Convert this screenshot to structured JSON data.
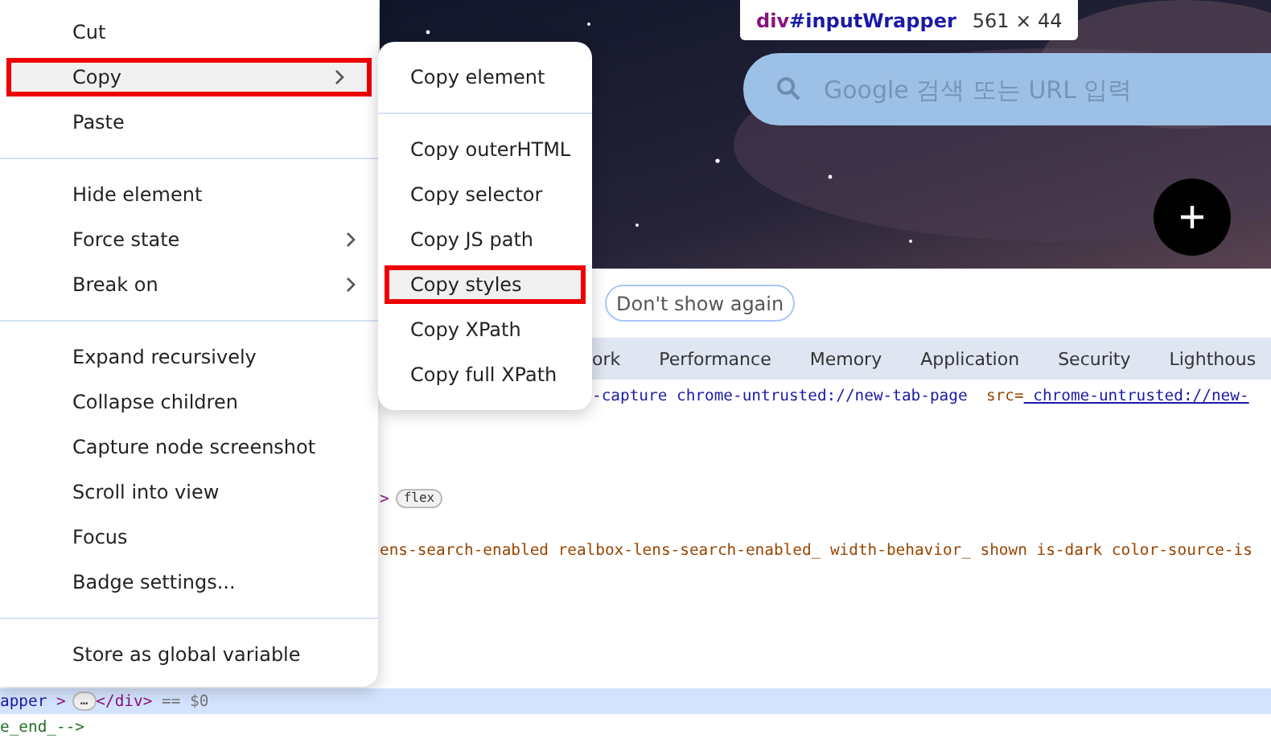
{
  "element_tooltip": {
    "tag": "div",
    "id": "#inputWrapper",
    "size": "561 × 44"
  },
  "search_box": {
    "placeholder": "Google 검색 또는 URL 입력"
  },
  "banner": {
    "button": "Don't show again"
  },
  "tabs": [
    {
      "label": "ork",
      "selected": false
    },
    {
      "label": "Performance",
      "selected": false
    },
    {
      "label": "Memory",
      "selected": false
    },
    {
      "label": "Application",
      "selected": false
    },
    {
      "label": "Security",
      "selected": false
    },
    {
      "label": "Lighthous",
      "selected": false
    }
  ],
  "code_lines": [
    {
      "selected": false,
      "segments": [
        {
          "kind": "attr",
          "text": "-capture chrome-untrusted://new-tab-page "
        },
        {
          "kind": "name",
          "text": " src="
        },
        {
          "kind": "link",
          "text": " chrome-untrusted://new-"
        }
      ]
    },
    {
      "selected": false,
      "segments": [
        {
          "kind": "tag",
          "text": ">"
        },
        {
          "kind": "badge",
          "text": "flex"
        }
      ]
    },
    {
      "selected": false,
      "segments": [
        {
          "kind": "value",
          "text": "ens-search-enabled realbox-lens-search-enabled_ width-behavior_ shown is-dark color-source-is"
        }
      ]
    },
    {
      "selected": true,
      "segments": [
        {
          "kind": "attr",
          "text": "apper"
        },
        {
          "kind": "tag",
          "text": " >"
        },
        {
          "kind": "badge",
          "text": "…"
        },
        {
          "kind": "tag",
          "text": "</div>"
        },
        {
          "kind": "plain",
          "text": " == $0"
        }
      ]
    },
    {
      "selected": false,
      "segments": [
        {
          "kind": "comment",
          "text": "e_end_-->"
        }
      ]
    }
  ],
  "context_menu": {
    "items": [
      {
        "kind": "item",
        "label": "Cut",
        "has_submenu": false,
        "highlighted": false
      },
      {
        "kind": "item",
        "label": "Copy",
        "has_submenu": true,
        "highlighted": true
      },
      {
        "kind": "item",
        "label": "Paste",
        "has_submenu": false,
        "highlighted": false
      },
      {
        "kind": "separator"
      },
      {
        "kind": "item",
        "label": "Hide element",
        "has_submenu": false,
        "highlighted": false
      },
      {
        "kind": "item",
        "label": "Force state",
        "has_submenu": true,
        "highlighted": false
      },
      {
        "kind": "item",
        "label": "Break on",
        "has_submenu": true,
        "highlighted": false
      },
      {
        "kind": "separator"
      },
      {
        "kind": "item",
        "label": "Expand recursively",
        "has_submenu": false,
        "highlighted": false
      },
      {
        "kind": "item",
        "label": "Collapse children",
        "has_submenu": false,
        "highlighted": false
      },
      {
        "kind": "item",
        "label": "Capture node screenshot",
        "has_submenu": false,
        "highlighted": false
      },
      {
        "kind": "item",
        "label": "Scroll into view",
        "has_submenu": false,
        "highlighted": false
      },
      {
        "kind": "item",
        "label": "Focus",
        "has_submenu": false,
        "highlighted": false
      },
      {
        "kind": "item",
        "label": "Badge settings...",
        "has_submenu": false,
        "highlighted": false
      },
      {
        "kind": "separator"
      },
      {
        "kind": "item",
        "label": "Store as global variable",
        "has_submenu": false,
        "highlighted": false
      }
    ]
  },
  "copy_submenu": {
    "items": [
      {
        "kind": "item",
        "label": "Copy element",
        "highlighted": false
      },
      {
        "kind": "separator"
      },
      {
        "kind": "item",
        "label": "Copy outerHTML",
        "highlighted": false
      },
      {
        "kind": "item",
        "label": "Copy selector",
        "highlighted": false
      },
      {
        "kind": "item",
        "label": "Copy JS path",
        "highlighted": false
      },
      {
        "kind": "item",
        "label": "Copy styles",
        "highlighted": true
      },
      {
        "kind": "item",
        "label": "Copy XPath",
        "highlighted": false
      },
      {
        "kind": "item",
        "label": "Copy full XPath",
        "highlighted": false
      }
    ]
  }
}
